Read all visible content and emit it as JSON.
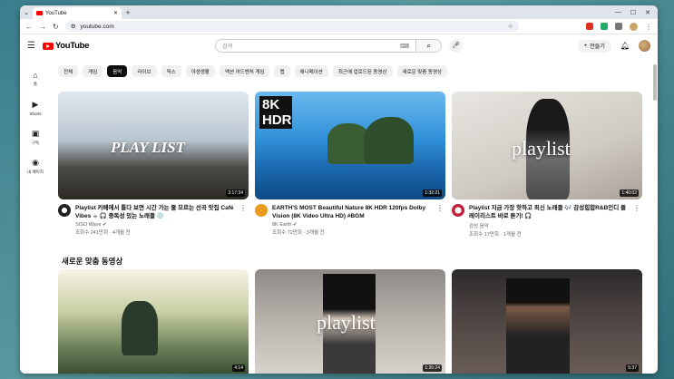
{
  "browser": {
    "tab_title": "YouTube",
    "url": "youtube.com"
  },
  "header": {
    "logo": "YouTube",
    "search_placeholder": "검색",
    "create_label": "만들기"
  },
  "sidebar": {
    "items": [
      {
        "label": "홈",
        "icon": "home-icon"
      },
      {
        "label": "Shorts",
        "icon": "shorts-icon"
      },
      {
        "label": "구독",
        "icon": "subscriptions-icon"
      },
      {
        "label": "내 페이지",
        "icon": "profile-icon"
      }
    ]
  },
  "chips": [
    "전체",
    "게임",
    "음악",
    "라이브",
    "믹스",
    "야생생활",
    "액션 어드벤처 게임",
    "랩",
    "애니메이션",
    "최근에 업로드된 동영상",
    "새로운 맞춤 동영상"
  ],
  "videos": [
    {
      "title": "Playlist 카페에서 틀다 보면 시간 가는 줄 모르는 선곡 맛집 Café Vibes ☕ 🎧 중독성 있는 노래들 💿",
      "channel": "SISO Wave ✔",
      "stats": "조회수 241만회 · 4개월 전",
      "duration": "3:17:34",
      "overlay": "PLAY LIST"
    },
    {
      "title": "EARTH'S MOST Beautiful Nature 8K HDR 120fps Dolby Vision (8K Video Ultra HD) #BGM",
      "channel": "8K Earth ✔",
      "stats": "조회수 72만회 · 3개월 전",
      "duration": "1:32:21",
      "overlay": "8K HDR"
    },
    {
      "title": "Playlist 지금 가장 핫하고 최신 노래들 🎶 감성힙합R&B인디 플레이리스트 바로 듣기! 🎧",
      "channel": "감성 음악",
      "stats": "조회수 17만회 · 1개월 전",
      "duration": "1:40:02",
      "overlay": "playlist"
    }
  ],
  "section_title": "새로운 맞춤 동영상",
  "videos2": [
    {
      "duration": "4:14"
    },
    {
      "duration": "1:35:24",
      "overlay": "playlist"
    },
    {
      "duration": "5:37"
    }
  ]
}
